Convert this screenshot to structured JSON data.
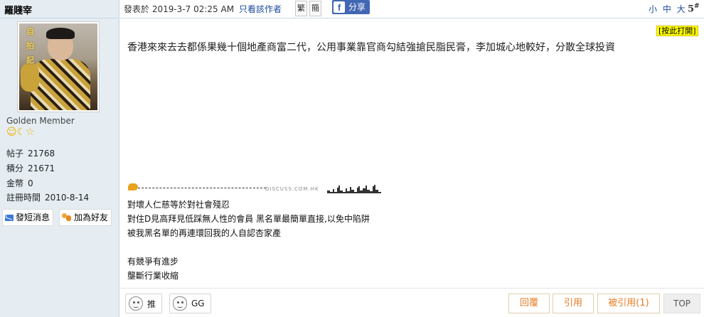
{
  "user": {
    "name": "羅賤宰",
    "avatar_text": "自\n拍\n記",
    "rank": "Golden Member",
    "stats": [
      {
        "label": "帖子",
        "value": "21768"
      },
      {
        "label": "積分",
        "value": "21671"
      },
      {
        "label": "金幣",
        "value": "0"
      },
      {
        "label": "註冊時間",
        "value": "2010-8-14"
      }
    ],
    "send_message": "發短消息",
    "add_friend": "加為好友"
  },
  "header": {
    "posted_at": "發表於 2019-3-7 02:25 AM",
    "author_only": "只看該作者",
    "traditional": "繁",
    "simplified": "簡",
    "share": "分享",
    "font_sizes": "小 中 大",
    "floor": "5",
    "floor_mark": "#"
  },
  "post": {
    "print_label": "[按此打開]",
    "content": "香港來來去去都係果幾十個地產商富二代，公用事業靠官商勾結強搶民脂民膏，李加城心地較好，分散全球投資"
  },
  "signature": {
    "logo_text": "DISCUSS.COM.HK",
    "lines": [
      "對壞人仁慈等於對社會殘忍",
      "對住D見高拜見低踩無人性的會員 黑名單最簡單直接,以免中陷阱",
      "被我黑名單的再連環回我的人自認杏家產",
      "",
      "有競爭有進步",
      "壟斷行業收縮"
    ]
  },
  "footer": {
    "push": "推",
    "gg": "GG",
    "reply": "回覆",
    "quote": "引用",
    "quoted": "被引用(1)",
    "top": "TOP"
  },
  "colors": {
    "sidebar_bg": "#e5edf2",
    "link_blue": "#1a4a9a",
    "facebook_blue": "#4267b2",
    "action_orange": "#e87b22",
    "print_highlight": "#ffff00"
  }
}
